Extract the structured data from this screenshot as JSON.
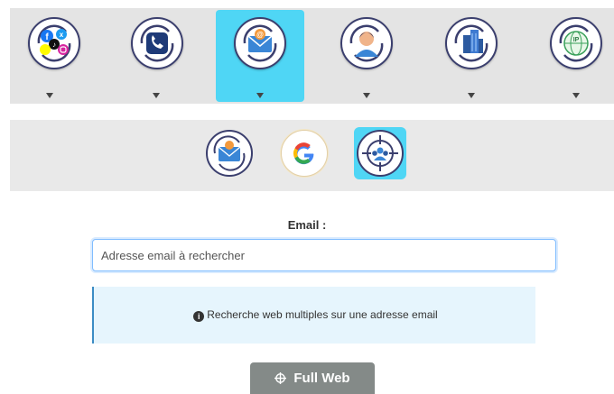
{
  "categories": [
    {
      "name": "social-networks",
      "icon": "social-networks-icon",
      "active": false
    },
    {
      "name": "phone",
      "icon": "phone-icon",
      "active": false
    },
    {
      "name": "email",
      "icon": "email-icon",
      "active": true
    },
    {
      "name": "person",
      "icon": "person-icon",
      "active": false
    },
    {
      "name": "company",
      "icon": "building-icon",
      "active": false
    },
    {
      "name": "ip",
      "icon": "ip-globe-icon",
      "active": false,
      "badge": "IP"
    }
  ],
  "subtools": [
    {
      "name": "email-lookup",
      "icon": "email-refresh-icon",
      "active": false
    },
    {
      "name": "google",
      "icon": "google-icon",
      "active": false
    },
    {
      "name": "target-search",
      "icon": "target-group-icon",
      "active": true
    }
  ],
  "form": {
    "label": "Email :",
    "placeholder": "Adresse email à rechercher",
    "value": ""
  },
  "info": {
    "icon": "info-icon",
    "text": "Recherche web multiples sur une adresse email"
  },
  "button": {
    "label": "Full Web",
    "icon": "crosshair-icon"
  },
  "colors": {
    "accent": "#4fd6f5",
    "icon_outline": "#3b3f6e",
    "info_bg": "#e6f5fd",
    "button_bg": "#848a88"
  }
}
